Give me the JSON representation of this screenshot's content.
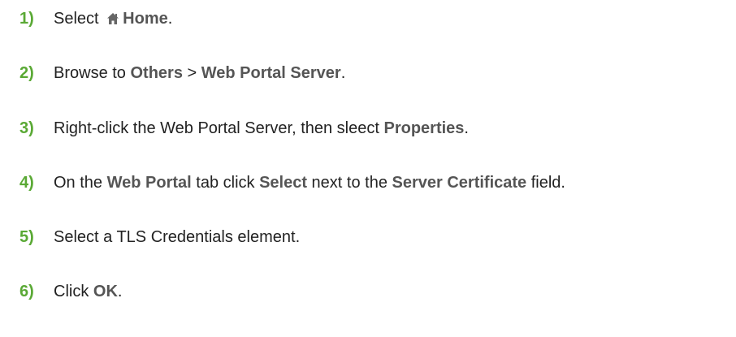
{
  "steps": [
    {
      "num": "1)",
      "parts": {
        "a": "Select ",
        "icon": "home-icon",
        "b": "Home",
        "c": "."
      }
    },
    {
      "num": "2)",
      "parts": {
        "a": "Browse to ",
        "b": "Others",
        "c": " > ",
        "d": "Web Portal Server",
        "e": "."
      }
    },
    {
      "num": "3)",
      "parts": {
        "a": "Right-click the Web Portal Server, then sleect ",
        "b": "Properties",
        "c": "."
      }
    },
    {
      "num": "4)",
      "parts": {
        "a": "On the ",
        "b": "Web Portal",
        "c": " tab click ",
        "d": "Select",
        "e": " next to the ",
        "f": "Server Certificate",
        "g": " field."
      }
    },
    {
      "num": "5)",
      "parts": {
        "a": "Select a TLS Credentials element."
      }
    },
    {
      "num": "6)",
      "parts": {
        "a": "Click ",
        "b": "OK",
        "c": "."
      }
    }
  ],
  "colors": {
    "step_number": "#5aa935",
    "bold_term": "#555555",
    "text": "#222222"
  }
}
